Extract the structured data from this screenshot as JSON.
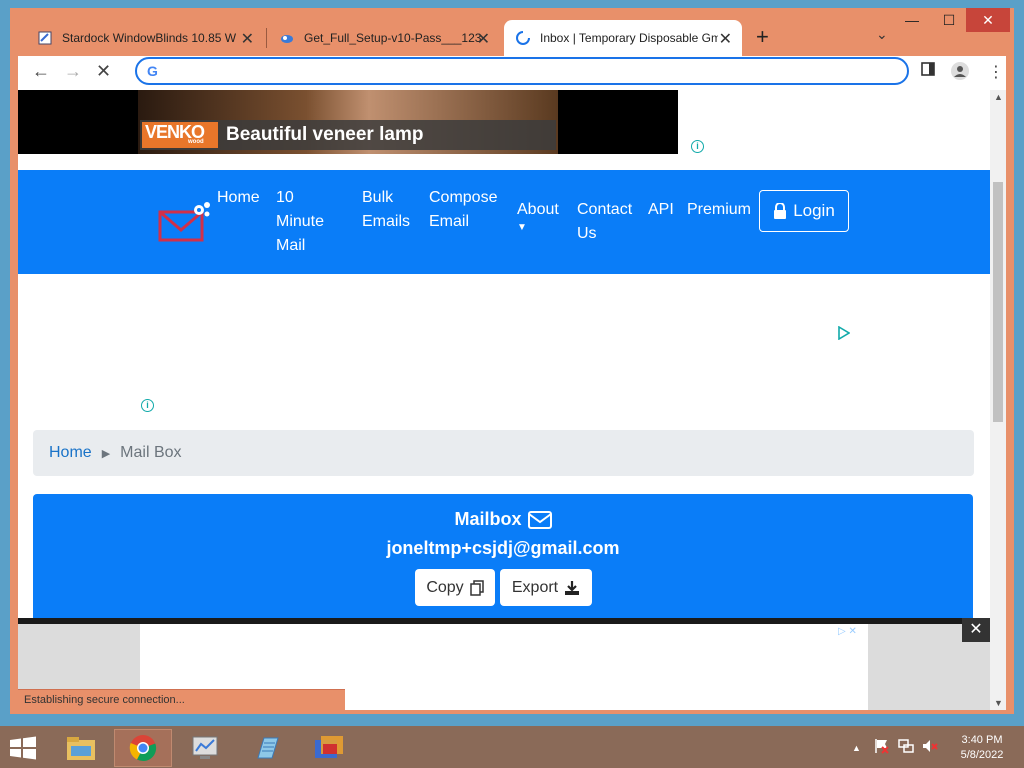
{
  "tabs": [
    {
      "title": "Stardock WindowBlinds 10.85 W",
      "close": "✕"
    },
    {
      "title": "Get_Full_Setup-v10-Pass___123",
      "close": "✕"
    },
    {
      "title": "Inbox | Temporary Disposable Gm",
      "close": "✕"
    }
  ],
  "toolbar": {
    "new_tab": "+",
    "tab_search": "⌄",
    "minimize": "—",
    "maximize": "☐",
    "close": "✕",
    "address_value": ""
  },
  "ad_top": {
    "brand": "VENKO",
    "brand_sub": "wood",
    "headline": "Beautiful veneer lamp"
  },
  "nav": {
    "home": "Home",
    "ten_minute_mail": [
      "10",
      "Minute",
      "Mail"
    ],
    "bulk_emails": [
      "Bulk",
      "Emails"
    ],
    "compose_email": [
      "Compose",
      "Email"
    ],
    "about": "About",
    "contact_us": [
      "Contact",
      "Us"
    ],
    "api": "API",
    "premium": "Premium",
    "login": "Login"
  },
  "breadcrumb": {
    "home": "Home",
    "current": "Mail Box"
  },
  "mailbox": {
    "title": "Mailbox",
    "email": "joneltmp+csjdj@gmail.com",
    "copy_label": "Copy",
    "export_label": "Export"
  },
  "status_text": "Establishing secure connection...",
  "clock": {
    "time": "3:40 PM",
    "date": "5/8/2022"
  },
  "colors": {
    "brand_blue": "#0a7df8",
    "window_frame": "#e8906a",
    "breadcrumb_bg": "#e9ecef"
  }
}
